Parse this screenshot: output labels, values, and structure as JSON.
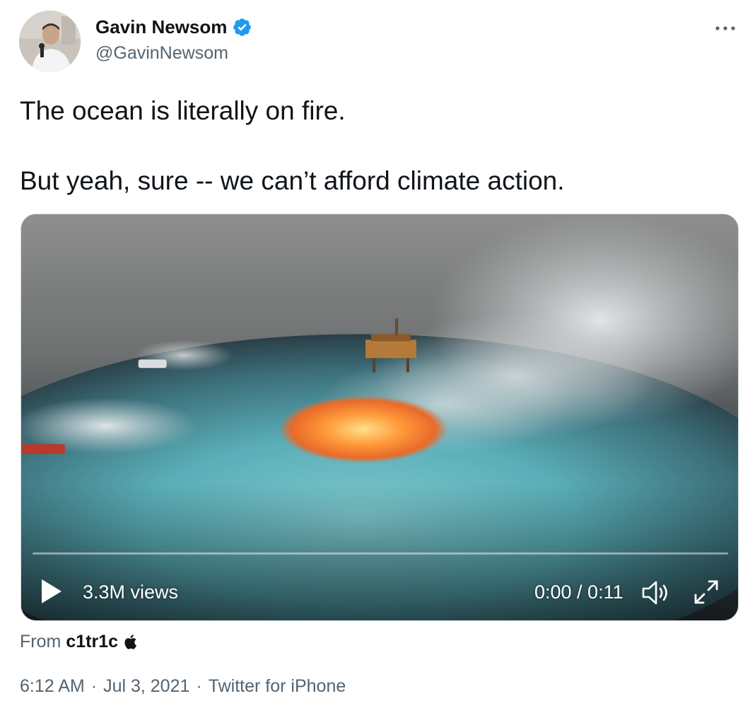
{
  "author": {
    "name": "Gavin Newsom",
    "handle": "@GavinNewsom",
    "verified": true,
    "avatar_icon": "profile-photo-icon"
  },
  "header": {
    "more_icon": "ellipsis-icon"
  },
  "tweet": {
    "lines": [
      "The ocean is literally on fire.",
      "But yeah, sure -- we can’t afford climate action."
    ]
  },
  "video": {
    "views": "3.3M views",
    "time": "0:00 / 0:11",
    "progress_fraction": 0,
    "icons": {
      "play": "play-icon",
      "volume": "volume-icon",
      "expand": "expand-icon"
    }
  },
  "source": {
    "prefix": "From",
    "name": "c1tr1c",
    "icon": "apple-icon"
  },
  "meta": {
    "time": "6:12 AM",
    "date": "Jul 3, 2021",
    "client": "Twitter for iPhone",
    "separator": "·"
  },
  "colors": {
    "text": "#0f1419",
    "secondary": "#536471",
    "verified_blue": "#1d9bf0",
    "border": "#cfd9de"
  }
}
